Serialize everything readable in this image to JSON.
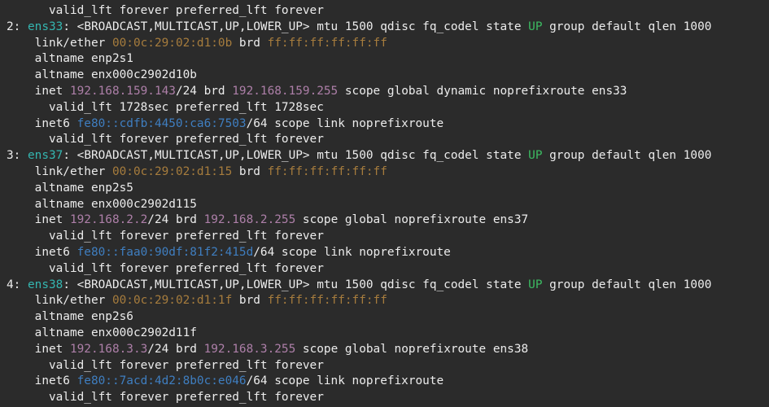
{
  "terminal": {
    "lines": [
      [
        {
          "t": "      valid_lft forever preferred_lft forever",
          "c": "txt"
        }
      ],
      [
        {
          "t": "2: ",
          "c": "txt"
        },
        {
          "t": "ens33",
          "c": "iface"
        },
        {
          "t": ": <BROADCAST,MULTICAST,UP,LOWER_UP> mtu 1500 qdisc fq_codel state ",
          "c": "txt"
        },
        {
          "t": "UP",
          "c": "up"
        },
        {
          "t": " group default qlen 1000",
          "c": "txt"
        }
      ],
      [
        {
          "t": "    link/ether ",
          "c": "txt"
        },
        {
          "t": "00:0c:29:02:d1:0b",
          "c": "mac"
        },
        {
          "t": " brd ",
          "c": "txt"
        },
        {
          "t": "ff:ff:ff:ff:ff:ff",
          "c": "mac"
        }
      ],
      [
        {
          "t": "    altname enp2s1",
          "c": "txt"
        }
      ],
      [
        {
          "t": "    altname enx000c2902d10b",
          "c": "txt"
        }
      ],
      [
        {
          "t": "    inet ",
          "c": "txt"
        },
        {
          "t": "192.168.159.143",
          "c": "ip4"
        },
        {
          "t": "/24 brd ",
          "c": "txt"
        },
        {
          "t": "192.168.159.255",
          "c": "ip4"
        },
        {
          "t": " scope global dynamic noprefixroute ens33",
          "c": "txt"
        }
      ],
      [
        {
          "t": "      valid_lft 1728sec preferred_lft 1728sec",
          "c": "txt"
        }
      ],
      [
        {
          "t": "    inet6 ",
          "c": "txt"
        },
        {
          "t": "fe80::cdfb:4450:ca6:7503",
          "c": "ip6"
        },
        {
          "t": "/64 scope link noprefixroute",
          "c": "txt"
        }
      ],
      [
        {
          "t": "      valid_lft forever preferred_lft forever",
          "c": "txt"
        }
      ],
      [
        {
          "t": "3: ",
          "c": "txt"
        },
        {
          "t": "ens37",
          "c": "iface"
        },
        {
          "t": ": <BROADCAST,MULTICAST,UP,LOWER_UP> mtu 1500 qdisc fq_codel state ",
          "c": "txt"
        },
        {
          "t": "UP",
          "c": "up"
        },
        {
          "t": " group default qlen 1000",
          "c": "txt"
        }
      ],
      [
        {
          "t": "    link/ether ",
          "c": "txt"
        },
        {
          "t": "00:0c:29:02:d1:15",
          "c": "mac"
        },
        {
          "t": " brd ",
          "c": "txt"
        },
        {
          "t": "ff:ff:ff:ff:ff:ff",
          "c": "mac"
        }
      ],
      [
        {
          "t": "    altname enp2s5",
          "c": "txt"
        }
      ],
      [
        {
          "t": "    altname enx000c2902d115",
          "c": "txt"
        }
      ],
      [
        {
          "t": "    inet ",
          "c": "txt"
        },
        {
          "t": "192.168.2.2",
          "c": "ip4"
        },
        {
          "t": "/24 brd ",
          "c": "txt"
        },
        {
          "t": "192.168.2.255",
          "c": "ip4"
        },
        {
          "t": " scope global noprefixroute ens37",
          "c": "txt"
        }
      ],
      [
        {
          "t": "      valid_lft forever preferred_lft forever",
          "c": "txt"
        }
      ],
      [
        {
          "t": "    inet6 ",
          "c": "txt"
        },
        {
          "t": "fe80::faa0:90df:81f2:415d",
          "c": "ip6"
        },
        {
          "t": "/64 scope link noprefixroute",
          "c": "txt"
        }
      ],
      [
        {
          "t": "      valid_lft forever preferred_lft forever",
          "c": "txt"
        }
      ],
      [
        {
          "t": "4: ",
          "c": "txt"
        },
        {
          "t": "ens38",
          "c": "iface"
        },
        {
          "t": ": <BROADCAST,MULTICAST,UP,LOWER_UP> mtu 1500 qdisc fq_codel state ",
          "c": "txt"
        },
        {
          "t": "UP",
          "c": "up"
        },
        {
          "t": " group default qlen 1000",
          "c": "txt"
        }
      ],
      [
        {
          "t": "    link/ether ",
          "c": "txt"
        },
        {
          "t": "00:0c:29:02:d1:1f",
          "c": "mac"
        },
        {
          "t": " brd ",
          "c": "txt"
        },
        {
          "t": "ff:ff:ff:ff:ff:ff",
          "c": "mac"
        }
      ],
      [
        {
          "t": "    altname enp2s6",
          "c": "txt"
        }
      ],
      [
        {
          "t": "    altname enx000c2902d11f",
          "c": "txt"
        }
      ],
      [
        {
          "t": "    inet ",
          "c": "txt"
        },
        {
          "t": "192.168.3.3",
          "c": "ip4"
        },
        {
          "t": "/24 brd ",
          "c": "txt"
        },
        {
          "t": "192.168.3.255",
          "c": "ip4"
        },
        {
          "t": " scope global noprefixroute ens38",
          "c": "txt"
        }
      ],
      [
        {
          "t": "      valid_lft forever preferred_lft forever",
          "c": "txt"
        }
      ],
      [
        {
          "t": "    inet6 ",
          "c": "txt"
        },
        {
          "t": "fe80::7acd:4d2:8b0c:e046",
          "c": "ip6"
        },
        {
          "t": "/64 scope link noprefixroute",
          "c": "txt"
        }
      ],
      [
        {
          "t": "      valid_lft forever preferred_lft forever",
          "c": "txt"
        }
      ]
    ]
  },
  "colors": {
    "background": "#2b2b2b",
    "text": "#ececec",
    "interface_name": "#34b6b0",
    "state_up": "#3cba62",
    "mac_address": "#a67c3d",
    "ipv4_address": "#ad7fa8",
    "ipv6_address": "#3f7ec0"
  }
}
